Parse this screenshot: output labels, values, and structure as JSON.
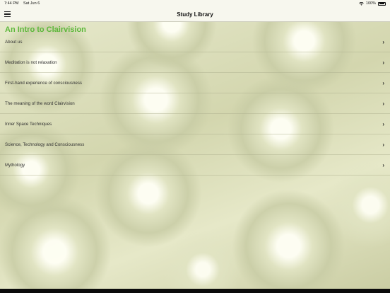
{
  "status_bar": {
    "time": "7:44 PM",
    "date": "Sat Jun 6",
    "battery": "100%",
    "icons": [
      "wifi-icon",
      "battery-icon"
    ]
  },
  "nav": {
    "title": "Study Library",
    "menu_icon": "hamburger-icon"
  },
  "page": {
    "heading": "An Intro to Clairvision",
    "heading_color": "#5cb83a"
  },
  "items": [
    {
      "label": "About us"
    },
    {
      "label": "Meditation is not relaxation"
    },
    {
      "label": "First-hand experience of consciousness"
    },
    {
      "label": "The meaning of the word Clairvision"
    },
    {
      "label": "Inner Space Techniques"
    },
    {
      "label": "Science, Technology and Consciousness"
    },
    {
      "label": "Mythology"
    }
  ],
  "chevron_glyph": "›"
}
